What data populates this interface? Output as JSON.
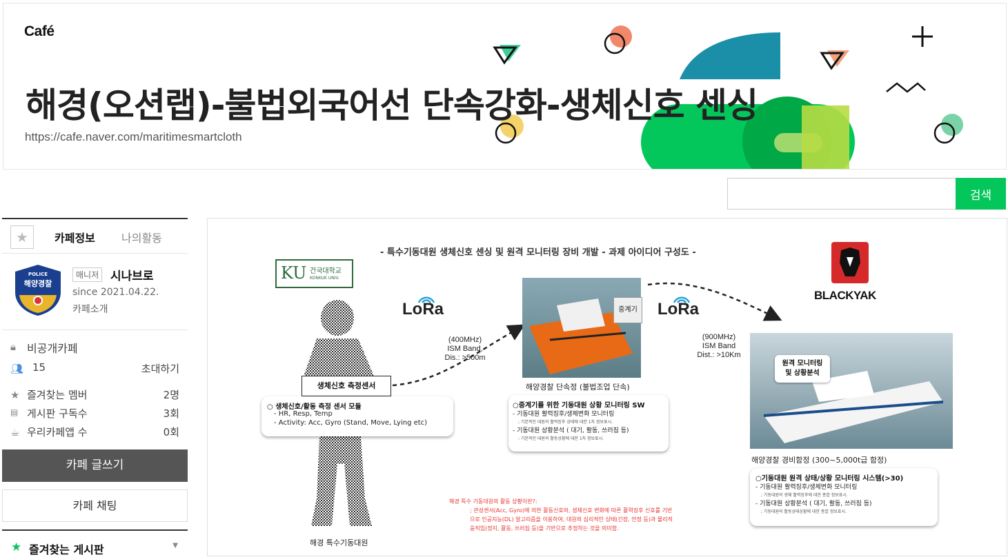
{
  "header": {
    "logo": "Café",
    "title": "해경(오션랩)-불법외국어선 단속강화-생체신호 센싱",
    "url": "https://cafe.naver.com/maritimesmartcloth"
  },
  "search": {
    "button_label": "검색",
    "placeholder": ""
  },
  "sidebar": {
    "tabs": {
      "info": "카페정보",
      "activity": "나의활동"
    },
    "profile": {
      "avatar_top": "POLICE",
      "avatar_label": "해양경찰",
      "badge": "매니저",
      "name": "시나브로",
      "since": "since 2021.04.22.",
      "intro": "카페소개"
    },
    "stats": {
      "private": "비공개카페",
      "members": "15",
      "invite": "초대하기",
      "fav_members_label": "즐겨찾는 멤버",
      "fav_members_value": "2명",
      "subscribers_label": "게시판 구독수",
      "subscribers_value": "3회",
      "app_label": "우리카페앱 수",
      "app_value": "0회"
    },
    "write_button": "카페 글쓰기",
    "chat_button": "카페 채팅",
    "fav_boards": "즐겨찾는 게시판"
  },
  "post_image": {
    "heading": "- 특수기동대원 생체신호 센싱 및 원격 모니터링 장비 개발 - 과제 아이디어 구성도 -",
    "ku_logo": "KU",
    "ku_name": "건국대학교",
    "ku_name_en": "KONKUK UNIV.",
    "blackyak": "BLACKYAK",
    "lora": "LoRa",
    "relay": "중계기",
    "link1": [
      "(400MHz)",
      "ISM Band,",
      "Dis.: >500m"
    ],
    "link2": [
      "(900MHz)",
      "ISM Band",
      "Dist.: >10Km"
    ],
    "sensor_label": "생체신호 측정센서",
    "sensor_box": {
      "title": "○ 생체신호/활동 측정 센서 모듈",
      "lines": [
        "- HR, Resp, Temp",
        "- Activity: Acc, Gyro (Stand, Move, Lying etc)"
      ]
    },
    "boat_caption": "해양경찰 단속정 (불법조업 단속)",
    "boat_box": {
      "title": "○중계기를 위한 기동대원 상황 모니터링 SW",
      "lines": [
        "- 기동대원 활력징후/생체변화 모니터링",
        "; 기본적인 대원의 활력징후 상태에 대한 1차 정보표시.",
        "- 기동대원 상황분석 ( 대기, 활동, 쓰러짐 등)",
        "; 기본적인 대원의 활동상황에 대한 1차 정보표시."
      ]
    },
    "ship_label": "원격 모니터링\n및 상황분석",
    "ship_caption": "해양경찰 경비함정 (300~5,000t급 함정)",
    "ship_box": {
      "title": "○기동대원 원격 상태/상황 모니터링 시스템(>30)",
      "lines": [
        "- 기동대원 활력징후/생체변화 모니터링",
        "; 기동대원의 생체 활력징후에 대한 종합 정보표시.",
        "- 기동대원 상황분석 ( 대기, 활동, 쓰러짐 등)",
        "; 기동대원의 활동상태상황에 대한 종합 정보표시."
      ]
    },
    "red_note": [
      "해경 특수 기동대원의 활동 상황이란?:",
      "; 관성센서(Acc, Gyro)에 의한 활동신호와, 생체신호 변화에 따른 활력징후 신호를 기반",
      "으로 인공지능(DL) 알고리즘을 이용하여, 대원의 심리적인 상태(긴장, 안정 등)과 물리적",
      "움직임(정지, 활동, 쓰러짐 등)을 기반으로 추정하는 것을 의미함."
    ],
    "person_caption": "해경 특수기동대원"
  },
  "colors": {
    "brand_green": "#03c75a",
    "note_red": "#e8322e"
  }
}
